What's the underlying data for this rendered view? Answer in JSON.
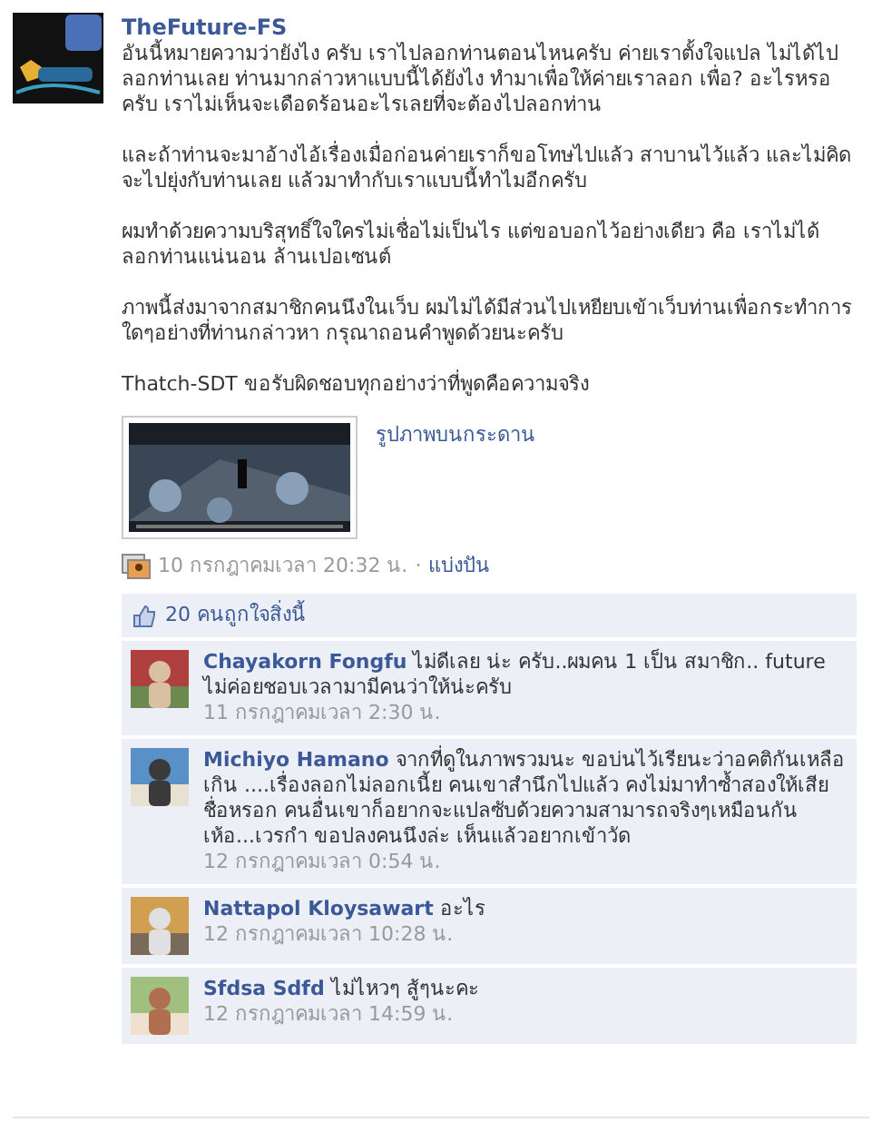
{
  "post": {
    "author": "TheFuture-FS",
    "paragraphs": [
      "อันนี้หมายความว่ายังไง ครับ เราไปลอกท่านตอนไหนครับ ค่ายเราตั้งใจแปล ไม่ได้ไปลอกท่านเลย ท่านมากล่าวหาแบบนี้ได้ยังไง ทำมาเพื่อให้ค่ายเราลอก เพื่อ? อะไรหรอครับ เราไม่เห็นจะเดือดร้อนอะไรเลยที่จะต้องไปลอกท่าน",
      "และถ้าท่านจะมาอ้างไอ้เรื่องเมื่อก่อนค่ายเราก็ขอโทษไปแล้ว สาบานไว้แล้ว และไม่คิดจะไปยุ่งกับท่านเลย แล้วมาทำกับเราแบบนี้ทำไมอีกครับ",
      "ผมทำด้วยความบริสุทธิ์ใจใครไม่เชื่อไม่เป็นไร แต่ขอบอกไว้อย่างเดียว คือ เราไม่ได้ลอกท่านแน่นอน ล้านเปอเซนต์",
      "ภาพนี้ส่งมาจากสมาชิกคนนึงในเว็บ ผมไม่ได้มีส่วนไปเหยียบเข้าเว็บท่านเพื่อกระทำการใดๆอย่างที่ท่านกล่าวหา กรุณาถอนคำพูดด้วยนะครับ",
      "Thatch-SDT ขอรับผิดชอบทุกอย่างว่าที่พูดคือความจริง"
    ],
    "attachment_link": "รูปภาพบนกระดาน",
    "timestamp": "10 กรกฎาคมเวลา 20:32 น.",
    "separator": "·",
    "share": "แบ่งปัน",
    "likes": "20 คนถูกใจสิ่งนี้"
  },
  "comments": [
    {
      "author": "Chayakorn Fongfu",
      "text": "ไม่ดีเลย น่ะ ครับ..ผมคน 1 เป็น สมาชิก.. future ไม่ค่อยชอบเวลามามีคนว่าให้น่ะครับ",
      "time": "11 กรกฎาคมเวลา 2:30 น."
    },
    {
      "author": "Michiyo Hamano",
      "text": "จากที่ดูในภาพรวมนะ ขอบ่นไว้เรียนะว่าอคติกันเหลือเกิน ....เรื่องลอกไม่ลอกเนี้ย คนเขาสำนึกไปแล้ว คงไม่มาทำซ้ำสองให้เสียชื่อหรอก คนอื่นเขาก็อยากจะแปลซับด้วยความสามารถจริงๆเหมือนกัน เห้อ...เวรกำ ขอปลงคนนึงล่ะ เห็นแล้วอยากเข้าวัด",
      "time": "12 กรกฎาคมเวลา 0:54 น."
    },
    {
      "author": "Nattapol Kloysawart",
      "text": "อะไร",
      "time": "12 กรกฎาคมเวลา 10:28 น."
    },
    {
      "author": "Sfdsa Sdfd",
      "text": "ไม่ไหวๆ สู้ๆนะคะ",
      "time": "12 กรกฎาคมเวลา 14:59 น."
    }
  ]
}
